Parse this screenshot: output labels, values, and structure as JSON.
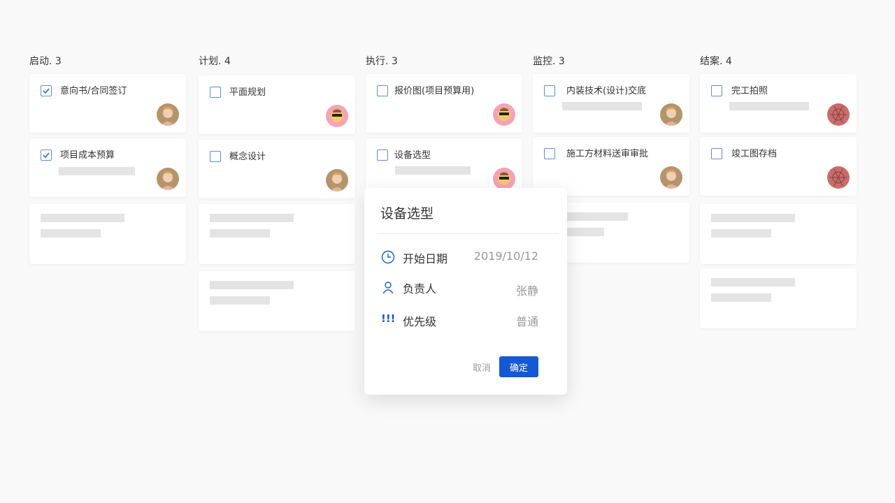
{
  "columns": [
    {
      "title": "启动. 3",
      "tasks": [
        "意向书/合同签订",
        "项目成本预算"
      ]
    },
    {
      "title": "计划. 4",
      "tasks": [
        "平面规划",
        "概念设计"
      ]
    },
    {
      "title": "执行. 3",
      "tasks": [
        "报价图(项目预算用)",
        "设备选型"
      ]
    },
    {
      "title": "监控. 3",
      "tasks": [
        "内装技术(设计)交底",
        "施工方材料送审审批"
      ]
    },
    {
      "title": "结案. 4",
      "tasks": [
        "完工拍照",
        "竣工图存档"
      ]
    }
  ],
  "popup": {
    "title": "设备选型",
    "start_date_label": "开始日期",
    "start_date_value": "2019/10/12",
    "owner_label": "负责人",
    "owner_value": "张静",
    "priority_label": "优先级",
    "priority_value": "普通",
    "priority_icon": "!!!",
    "cancel": "取消",
    "confirm": "确定"
  },
  "colors": {
    "accent": "#1558d6",
    "checkbox": "#5b8fd9",
    "placeholder": "#e4e4e4"
  }
}
